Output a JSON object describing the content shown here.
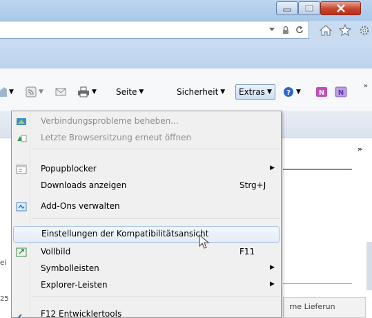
{
  "window": {
    "minimize_icon": "minimize-icon",
    "maximize_icon": "maximize-icon",
    "close_icon": "close-icon"
  },
  "address_bar": {
    "icons": [
      "dropdown-arrow-icon",
      "lock-icon",
      "refresh-icon"
    ]
  },
  "nav_icons": [
    "home-icon",
    "favorites-star-icon",
    "settings-gear-icon"
  ],
  "command_bar": {
    "seite_label": "Seite",
    "sicherheit_label": "Sicherheit",
    "extras_label": "Extras",
    "overflow": "»"
  },
  "page_behind": {
    "tab_overflow": "»",
    "left_stub": "ei",
    "left_bottom": "25",
    "bottom_right_text": "rne Lieferun"
  },
  "menu": {
    "items": [
      {
        "label": "Verbindungsprobleme beheben...",
        "shortcut": "",
        "submenu": false,
        "disabled": true,
        "icon": "network-diagnose-icon"
      },
      {
        "label": "Letzte Browsersitzung erneut öffnen",
        "shortcut": "",
        "submenu": false,
        "disabled": true,
        "icon": "reopen-session-icon"
      },
      {
        "label": "Popupblocker",
        "shortcut": "",
        "submenu": true,
        "disabled": false,
        "icon": "popup-blocker-icon"
      },
      {
        "label": "Downloads anzeigen",
        "shortcut": "Strg+J",
        "submenu": false,
        "disabled": false,
        "icon": ""
      },
      {
        "label": "Add-Ons verwalten",
        "shortcut": "",
        "submenu": false,
        "disabled": false,
        "icon": "addons-icon"
      },
      {
        "label": "Einstellungen der Kompatibilitätsansicht",
        "shortcut": "",
        "submenu": false,
        "disabled": false,
        "icon": "",
        "highlighted": true
      },
      {
        "label": "Vollbild",
        "shortcut": "F11",
        "submenu": false,
        "disabled": false,
        "icon": "fullscreen-icon"
      },
      {
        "label": "Symbolleisten",
        "shortcut": "",
        "submenu": true,
        "disabled": false,
        "icon": ""
      },
      {
        "label": "Explorer-Leisten",
        "shortcut": "",
        "submenu": true,
        "disabled": false,
        "icon": ""
      },
      {
        "label": "F12 Entwicklertools",
        "shortcut": "",
        "submenu": false,
        "disabled": false,
        "icon": "devtools-icon"
      }
    ]
  },
  "colors": {
    "highlight_border": "#a8c3e4",
    "menu_bg": "#f0f0f0",
    "disabled_text": "#8d8d8d",
    "close_red": "#c8442c"
  }
}
